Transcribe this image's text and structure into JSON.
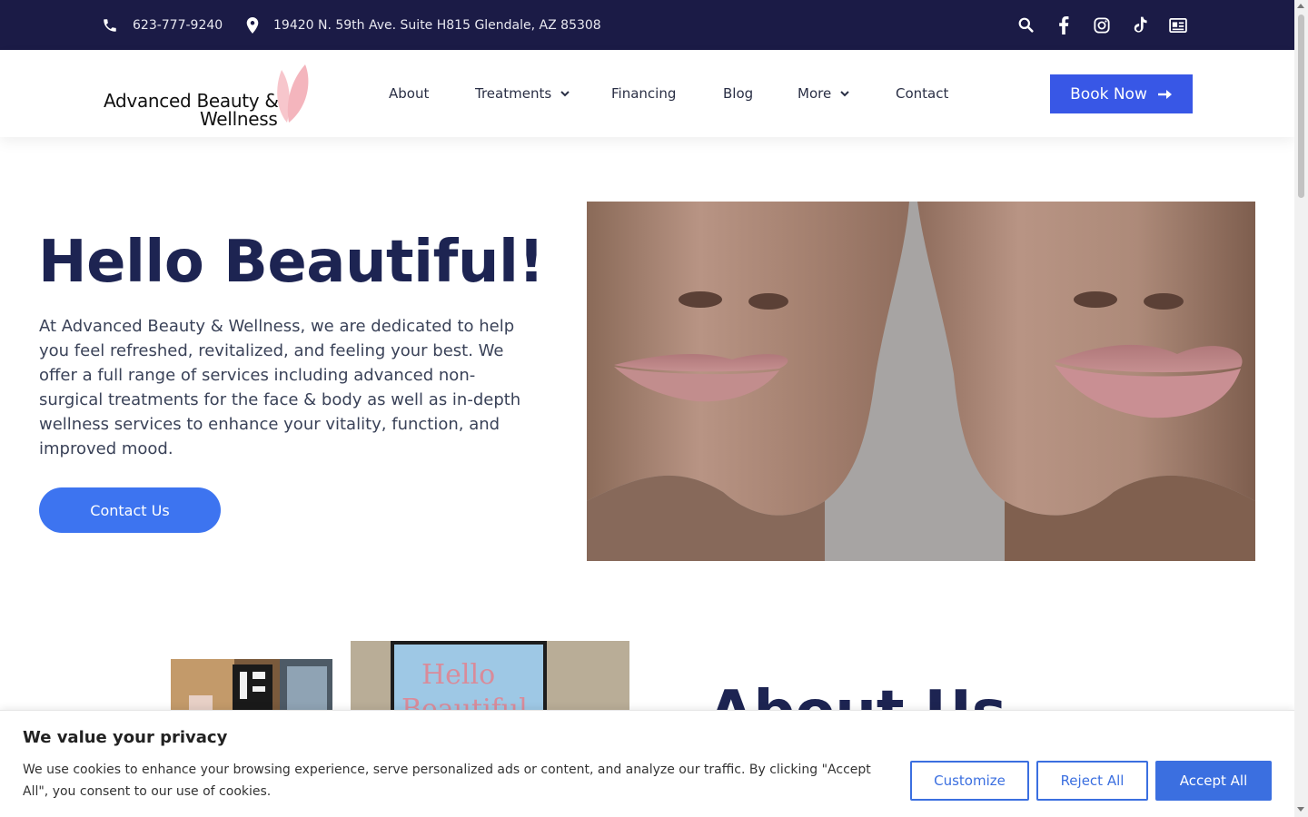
{
  "topbar": {
    "phone": "623-777-9240",
    "address": "19420 N. 59th Ave. Suite H815 Glendale, AZ 85308",
    "icons": [
      "search-icon",
      "facebook-icon",
      "instagram-icon",
      "tiktok-icon",
      "contact-card-icon"
    ]
  },
  "header": {
    "logo_line1": "Advanced Beauty &",
    "logo_line2": "Wellness",
    "nav": {
      "about": "About",
      "treatments": "Treatments",
      "financing": "Financing",
      "blog": "Blog",
      "more": "More",
      "contact": "Contact"
    },
    "book_now": "Book Now"
  },
  "hero": {
    "title": "Hello Beautiful!",
    "text": "At Advanced Beauty & Wellness, we are dedicated to help you feel refreshed, revitalized, and feeling your best.  We offer a full range of services including advanced non-surgical treatments for the face & body as well as in-depth wellness services to enhance your vitality, function, and improved mood.",
    "cta": "Contact Us"
  },
  "about": {
    "heading": "About Us",
    "screen_text_1": "Hello",
    "screen_text_2": "Beautiful"
  },
  "cookie": {
    "title": "We value your privacy",
    "text": "We use cookies to enhance your browsing experience, serve personalized ads or content, and analyze our traffic. By clicking \"Accept All\", you consent to our use of cookies.",
    "customize": "Customize",
    "reject": "Reject All",
    "accept": "Accept All"
  },
  "colors": {
    "topbar_bg": "#1b1b46",
    "heading": "#1d2452",
    "accent_blue": "#3d74f0",
    "book_button": "#3857e6",
    "logo_petal": "#f4b8c0"
  }
}
